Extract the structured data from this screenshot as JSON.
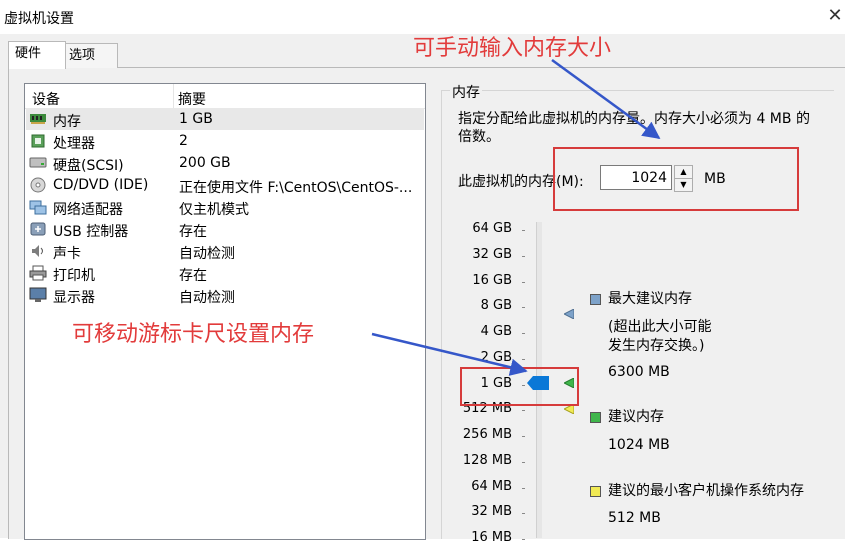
{
  "window": {
    "title": "虚拟机设置",
    "close_glyph": "✕"
  },
  "tabs": [
    {
      "label": "硬件",
      "active": true
    },
    {
      "label": "选项",
      "active": false
    }
  ],
  "device_table": {
    "columns": [
      "设备",
      "摘要"
    ],
    "rows": [
      {
        "icon": "memory-icon",
        "name": "内存",
        "summary": "1 GB",
        "selected": true
      },
      {
        "icon": "processor-icon",
        "name": "处理器",
        "summary": "2",
        "selected": false
      },
      {
        "icon": "hard-disk-icon",
        "name": "硬盘(SCSI)",
        "summary": "200 GB",
        "selected": false
      },
      {
        "icon": "cd-dvd-icon",
        "name": "CD/DVD (IDE)",
        "summary": "正在使用文件 F:\\CentOS\\CentOS-...",
        "selected": false
      },
      {
        "icon": "network-adapter-icon",
        "name": "网络适配器",
        "summary": "仅主机模式",
        "selected": false
      },
      {
        "icon": "usb-icon",
        "name": "USB 控制器",
        "summary": "存在",
        "selected": false
      },
      {
        "icon": "sound-card-icon",
        "name": "声卡",
        "summary": "自动检测",
        "selected": false
      },
      {
        "icon": "printer-icon",
        "name": "打印机",
        "summary": "存在",
        "selected": false
      },
      {
        "icon": "display-icon",
        "name": "显示器",
        "summary": "自动检测",
        "selected": false
      }
    ]
  },
  "memory": {
    "group_title": "内存",
    "description": "指定分配给此虚拟机的内存量。内存大小必须为 4 MB 的倍数。",
    "field_label": "此虚拟机的内存(M):",
    "value": "1024",
    "unit": "MB",
    "scale_labels": [
      "64 GB",
      "32 GB",
      "16 GB",
      "8 GB",
      "4 GB",
      "2 GB",
      "1 GB",
      "512 MB",
      "256 MB",
      "128 MB",
      "64 MB",
      "32 MB",
      "16 MB"
    ],
    "slider_value_mb": 1024,
    "legend": {
      "max": {
        "title": "最大建议内存",
        "note_line1": "(超出此大小可能",
        "note_line2": "发生内存交换。)",
        "value": "6300 MB",
        "color": "#7da2c9"
      },
      "recommended": {
        "title": "建议内存",
        "value": "1024 MB",
        "color": "#3fb64b"
      },
      "min_guest": {
        "title": "建议的最小客户机操作系统内存",
        "value": "512 MB",
        "color": "#f1ea55"
      }
    }
  },
  "annotations": {
    "top": "可手动输入内存大小",
    "left": "可移动游标卡尺设置内存",
    "color": "#e23b3b"
  }
}
